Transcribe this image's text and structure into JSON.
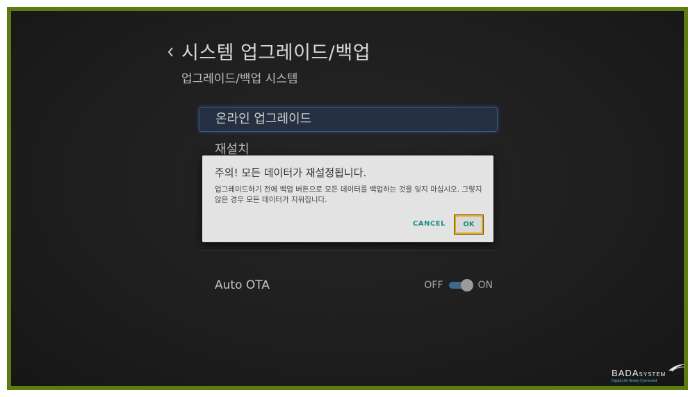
{
  "header": {
    "title": "시스템 업그레이드/백업",
    "subtitle": "업그레이드/백업 시스템",
    "back_icon": "chevron-left-icon"
  },
  "menu": {
    "items": [
      {
        "label": "온라인 업그레이드",
        "focused": true
      },
      {
        "label": "재설치",
        "focused": false
      }
    ],
    "auto_ota": {
      "label": "Auto OTA",
      "off_label": "OFF",
      "on_label": "ON",
      "state": "on"
    }
  },
  "dialog": {
    "title": "주의! 모든 데이터가 재설정됩니다.",
    "message": "업그레이드하기 전에 백업 버튼으로 모든 데이터를 백업하는 것을 잊지 마십시오. 그렇지 않은 경우 모든 데이터가 지워집니다.",
    "cancel_label": "CANCEL",
    "ok_label": "OK"
  },
  "brand": {
    "name": "BADA",
    "name_suffix": "SYSTEM",
    "tagline": "Digital Life Simply Connected"
  },
  "colors": {
    "frame_border": "#5e7a12",
    "accent": "#1c8f86",
    "focus_highlight": "#e0a81c",
    "toggle_track": "#3d6a8a"
  }
}
